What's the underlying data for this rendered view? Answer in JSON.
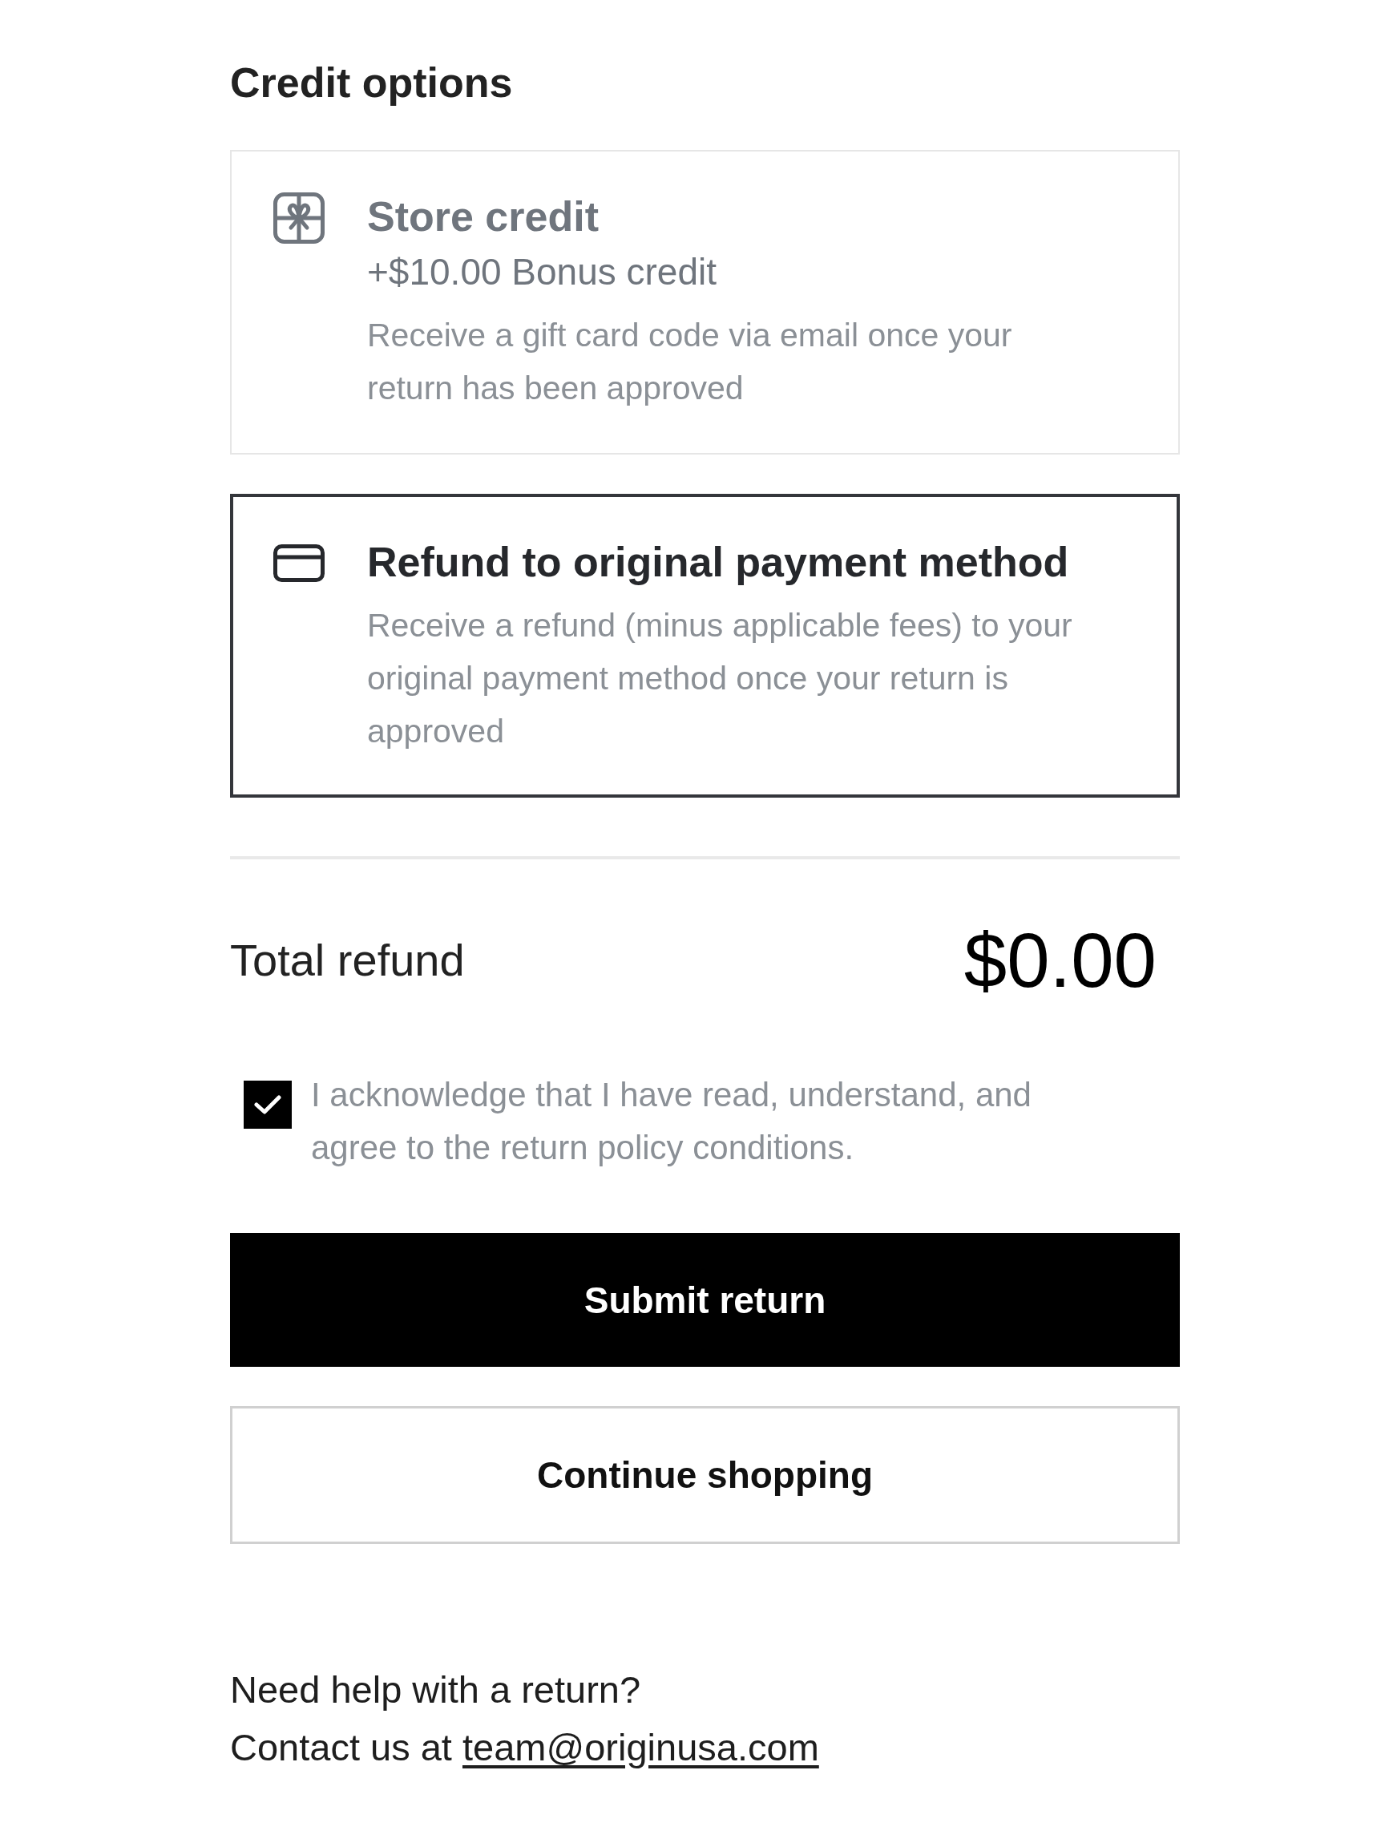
{
  "heading": "Credit options",
  "options": [
    {
      "kind": "gift",
      "title": "Store credit",
      "bonus": "+$10.00 Bonus credit",
      "description": "Receive a gift card code via email once your return has been approved",
      "selected": false
    },
    {
      "kind": "card",
      "title": "Refund to original payment method",
      "description": "Receive a refund (minus applicable fees) to your original payment method once your return is approved",
      "selected": true
    }
  ],
  "total": {
    "label": "Total refund",
    "amount": "$0.00"
  },
  "acknowledgement": {
    "text": "I acknowledge that I have read, understand, and agree to the return policy conditions.",
    "checked": true
  },
  "buttons": [
    {
      "kind": "primary",
      "label": "Submit return"
    },
    {
      "kind": "secondary",
      "label": "Continue shopping"
    }
  ],
  "help": {
    "question": "Need help with a return?",
    "contact_prefix": "Contact us at",
    "email": "team@originusa.com"
  }
}
